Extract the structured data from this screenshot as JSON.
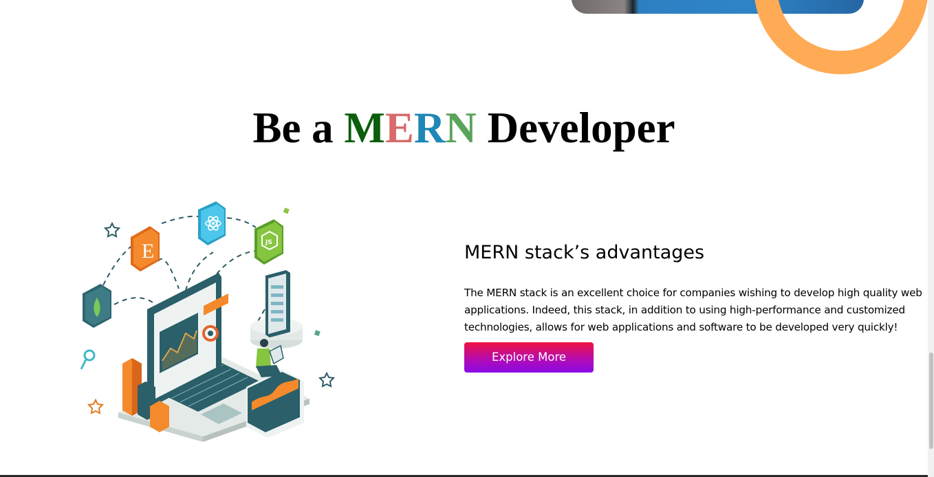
{
  "section": {
    "title_parts": {
      "before": "Be a",
      "m": "M",
      "e": "E",
      "r": "R",
      "n": "N",
      "after": "Developer"
    },
    "title_colors": {
      "m": "#0b5e0b",
      "e": "#d86a6a",
      "r": "#1f87b5",
      "n": "#5aa35a"
    },
    "subtitle": "MERN stack’s advantages",
    "description": "The MERN stack is an excellent choice for companies wishing to develop high quality web applications. Indeed, this stack, in addition to using high-performance and customized technologies, allows for web applications and software to be developed very quickly!",
    "cta_label": "Explore More",
    "illustration_icons": [
      "mongodb-leaf-icon",
      "express-e-icon",
      "react-atom-icon",
      "nodejs-icon"
    ]
  },
  "colors": {
    "accent_orange": "#ffaa55",
    "cta_gradient_top": "#f0123f",
    "cta_gradient_bottom": "#8a0ae6"
  }
}
